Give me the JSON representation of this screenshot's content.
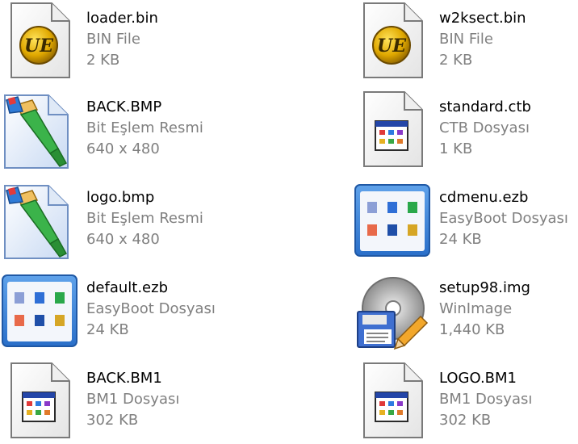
{
  "files": [
    {
      "name": "loader.bin",
      "type": "BIN File",
      "detail": "2 KB",
      "icon": "ultraedit-document-icon"
    },
    {
      "name": "w2ksect.bin",
      "type": "BIN File",
      "detail": "2 KB",
      "icon": "ultraedit-document-icon"
    },
    {
      "name": "BACK.BMP",
      "type": "Bit Eşlem Resmi",
      "detail": "640 x 480",
      "icon": "paint-bitmap-icon"
    },
    {
      "name": "standard.ctb",
      "type": "CTB Dosyası",
      "detail": "1 KB",
      "icon": "generic-application-document-icon"
    },
    {
      "name": "logo.bmp",
      "type": "Bit Eşlem Resmi",
      "detail": "640 x 480",
      "icon": "paint-bitmap-icon"
    },
    {
      "name": "cdmenu.ezb",
      "type": "EasyBoot Dosyası",
      "detail": "24 KB",
      "icon": "easyboot-file-icon"
    },
    {
      "name": "default.ezb",
      "type": "EasyBoot Dosyası",
      "detail": "24 KB",
      "icon": "easyboot-file-icon"
    },
    {
      "name": "setup98.img",
      "type": "WinImage",
      "detail": "1,440 KB",
      "icon": "winimage-disk-icon"
    },
    {
      "name": "BACK.BM1",
      "type": "BM1 Dosyası",
      "detail": "302 KB",
      "icon": "generic-application-document-icon"
    },
    {
      "name": "LOGO.BM1",
      "type": "BM1 Dosyası",
      "detail": "302 KB",
      "icon": "generic-application-document-icon"
    }
  ]
}
